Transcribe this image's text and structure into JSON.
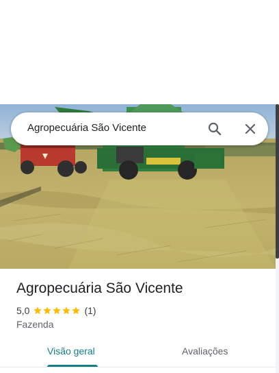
{
  "search": {
    "query": "Agropecuária São Vicente",
    "search_icon": "search-icon",
    "close_icon": "close-icon"
  },
  "hero": {
    "photo": "harvest-field-photo"
  },
  "place": {
    "name": "Agropecuária São Vicente",
    "rating_value": "5,0",
    "stars": 5,
    "review_count": "(1)",
    "category": "Fazenda"
  },
  "tabs": [
    {
      "label": "Visão geral",
      "active": true
    },
    {
      "label": "Avaliações",
      "active": false
    }
  ],
  "colors": {
    "accent": "#137f85",
    "star": "#fbbc04"
  }
}
